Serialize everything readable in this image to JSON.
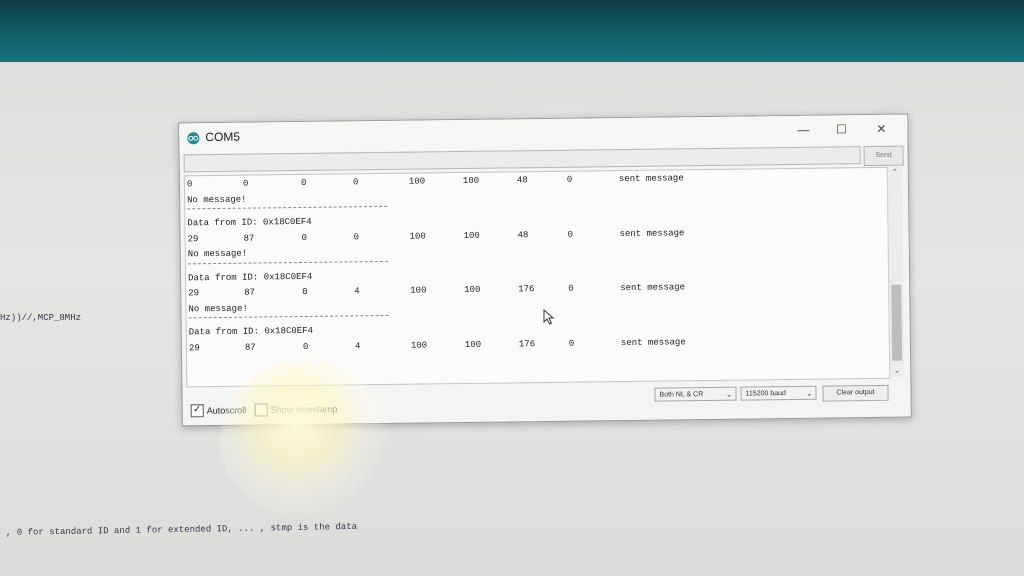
{
  "background_code": {
    "line_1": "Hz))//,MCP_8MHz",
    "line_2": ", 0 for standard ID and 1 for extended ID, ... , stmp is the data"
  },
  "window": {
    "title": "COM5",
    "icon": "arduino-icon",
    "controls": {
      "minimize": "—",
      "maximize": "☐",
      "close": "✕"
    }
  },
  "send": {
    "input_value": "",
    "button_label": "Send"
  },
  "output": {
    "rows": [
      {
        "c1": "0",
        "c2": "0",
        "c3": "0",
        "c4": "0",
        "c5": "100",
        "c6": "100",
        "c7": "48",
        "c8": "0",
        "msg": "sent message"
      },
      {
        "text": "No message!"
      },
      {
        "text": "Data from ID: 0x18C0EF4"
      },
      {
        "c1": "29",
        "c2": "87",
        "c3": "0",
        "c4": "0",
        "c5": "100",
        "c6": "100",
        "c7": "48",
        "c8": "0",
        "msg": "sent message"
      },
      {
        "text": "No message!"
      },
      {
        "text": "Data from ID: 0x18C0EF4"
      },
      {
        "c1": "29",
        "c2": "87",
        "c3": "0",
        "c4": "4",
        "c5": "100",
        "c6": "100",
        "c7": "176",
        "c8": "0",
        "msg": "sent message"
      },
      {
        "text": "No message!"
      },
      {
        "text": "Data from ID: 0x18C0EF4"
      },
      {
        "c1": "29",
        "c2": "87",
        "c3": "0",
        "c4": "4",
        "c5": "100",
        "c6": "100",
        "c7": "176",
        "c8": "0",
        "msg": "sent message"
      }
    ]
  },
  "bottom": {
    "autoscroll": {
      "label": "Autoscroll",
      "checked": true,
      "mark": "✓"
    },
    "show_timestamp": {
      "label": "Show timestamp",
      "checked": false
    },
    "line_ending": "Both NL & CR",
    "baud_rate": "115200 baud",
    "clear_label": "Clear output",
    "dropdown_glyph": "⌄"
  },
  "scrollbar": {
    "up": "⌃",
    "down": "⌄"
  },
  "colors": {
    "titlebar_teal": "#17737d",
    "app_icon": "#1b8c95"
  }
}
